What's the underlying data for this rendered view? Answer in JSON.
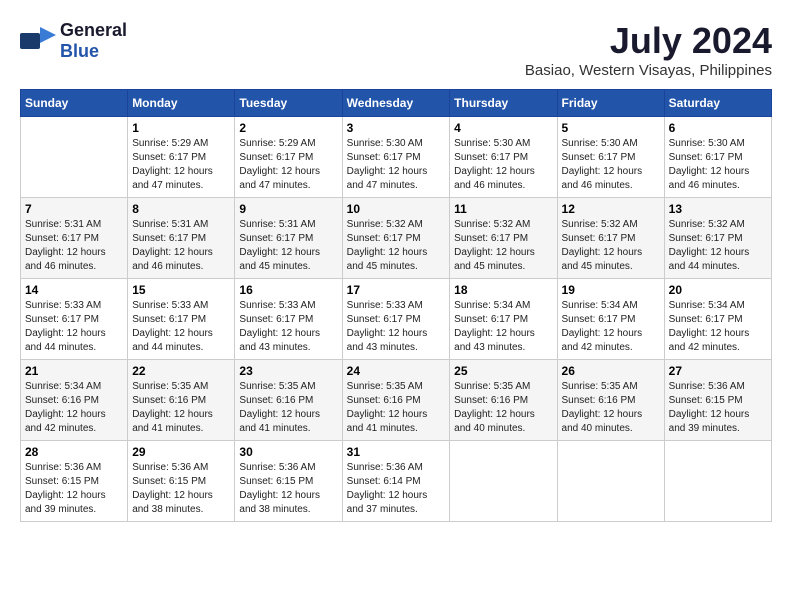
{
  "header": {
    "logo_general": "General",
    "logo_blue": "Blue",
    "title": "July 2024",
    "subtitle": "Basiao, Western Visayas, Philippines"
  },
  "calendar": {
    "days_of_week": [
      "Sunday",
      "Monday",
      "Tuesday",
      "Wednesday",
      "Thursday",
      "Friday",
      "Saturday"
    ],
    "weeks": [
      [
        {
          "day": "",
          "sunrise": "",
          "sunset": "",
          "daylight": ""
        },
        {
          "day": "1",
          "sunrise": "Sunrise: 5:29 AM",
          "sunset": "Sunset: 6:17 PM",
          "daylight": "Daylight: 12 hours and 47 minutes."
        },
        {
          "day": "2",
          "sunrise": "Sunrise: 5:29 AM",
          "sunset": "Sunset: 6:17 PM",
          "daylight": "Daylight: 12 hours and 47 minutes."
        },
        {
          "day": "3",
          "sunrise": "Sunrise: 5:30 AM",
          "sunset": "Sunset: 6:17 PM",
          "daylight": "Daylight: 12 hours and 47 minutes."
        },
        {
          "day": "4",
          "sunrise": "Sunrise: 5:30 AM",
          "sunset": "Sunset: 6:17 PM",
          "daylight": "Daylight: 12 hours and 46 minutes."
        },
        {
          "day": "5",
          "sunrise": "Sunrise: 5:30 AM",
          "sunset": "Sunset: 6:17 PM",
          "daylight": "Daylight: 12 hours and 46 minutes."
        },
        {
          "day": "6",
          "sunrise": "Sunrise: 5:30 AM",
          "sunset": "Sunset: 6:17 PM",
          "daylight": "Daylight: 12 hours and 46 minutes."
        }
      ],
      [
        {
          "day": "7",
          "sunrise": "Sunrise: 5:31 AM",
          "sunset": "Sunset: 6:17 PM",
          "daylight": "Daylight: 12 hours and 46 minutes."
        },
        {
          "day": "8",
          "sunrise": "Sunrise: 5:31 AM",
          "sunset": "Sunset: 6:17 PM",
          "daylight": "Daylight: 12 hours and 46 minutes."
        },
        {
          "day": "9",
          "sunrise": "Sunrise: 5:31 AM",
          "sunset": "Sunset: 6:17 PM",
          "daylight": "Daylight: 12 hours and 45 minutes."
        },
        {
          "day": "10",
          "sunrise": "Sunrise: 5:32 AM",
          "sunset": "Sunset: 6:17 PM",
          "daylight": "Daylight: 12 hours and 45 minutes."
        },
        {
          "day": "11",
          "sunrise": "Sunrise: 5:32 AM",
          "sunset": "Sunset: 6:17 PM",
          "daylight": "Daylight: 12 hours and 45 minutes."
        },
        {
          "day": "12",
          "sunrise": "Sunrise: 5:32 AM",
          "sunset": "Sunset: 6:17 PM",
          "daylight": "Daylight: 12 hours and 45 minutes."
        },
        {
          "day": "13",
          "sunrise": "Sunrise: 5:32 AM",
          "sunset": "Sunset: 6:17 PM",
          "daylight": "Daylight: 12 hours and 44 minutes."
        }
      ],
      [
        {
          "day": "14",
          "sunrise": "Sunrise: 5:33 AM",
          "sunset": "Sunset: 6:17 PM",
          "daylight": "Daylight: 12 hours and 44 minutes."
        },
        {
          "day": "15",
          "sunrise": "Sunrise: 5:33 AM",
          "sunset": "Sunset: 6:17 PM",
          "daylight": "Daylight: 12 hours and 44 minutes."
        },
        {
          "day": "16",
          "sunrise": "Sunrise: 5:33 AM",
          "sunset": "Sunset: 6:17 PM",
          "daylight": "Daylight: 12 hours and 43 minutes."
        },
        {
          "day": "17",
          "sunrise": "Sunrise: 5:33 AM",
          "sunset": "Sunset: 6:17 PM",
          "daylight": "Daylight: 12 hours and 43 minutes."
        },
        {
          "day": "18",
          "sunrise": "Sunrise: 5:34 AM",
          "sunset": "Sunset: 6:17 PM",
          "daylight": "Daylight: 12 hours and 43 minutes."
        },
        {
          "day": "19",
          "sunrise": "Sunrise: 5:34 AM",
          "sunset": "Sunset: 6:17 PM",
          "daylight": "Daylight: 12 hours and 42 minutes."
        },
        {
          "day": "20",
          "sunrise": "Sunrise: 5:34 AM",
          "sunset": "Sunset: 6:17 PM",
          "daylight": "Daylight: 12 hours and 42 minutes."
        }
      ],
      [
        {
          "day": "21",
          "sunrise": "Sunrise: 5:34 AM",
          "sunset": "Sunset: 6:16 PM",
          "daylight": "Daylight: 12 hours and 42 minutes."
        },
        {
          "day": "22",
          "sunrise": "Sunrise: 5:35 AM",
          "sunset": "Sunset: 6:16 PM",
          "daylight": "Daylight: 12 hours and 41 minutes."
        },
        {
          "day": "23",
          "sunrise": "Sunrise: 5:35 AM",
          "sunset": "Sunset: 6:16 PM",
          "daylight": "Daylight: 12 hours and 41 minutes."
        },
        {
          "day": "24",
          "sunrise": "Sunrise: 5:35 AM",
          "sunset": "Sunset: 6:16 PM",
          "daylight": "Daylight: 12 hours and 41 minutes."
        },
        {
          "day": "25",
          "sunrise": "Sunrise: 5:35 AM",
          "sunset": "Sunset: 6:16 PM",
          "daylight": "Daylight: 12 hours and 40 minutes."
        },
        {
          "day": "26",
          "sunrise": "Sunrise: 5:35 AM",
          "sunset": "Sunset: 6:16 PM",
          "daylight": "Daylight: 12 hours and 40 minutes."
        },
        {
          "day": "27",
          "sunrise": "Sunrise: 5:36 AM",
          "sunset": "Sunset: 6:15 PM",
          "daylight": "Daylight: 12 hours and 39 minutes."
        }
      ],
      [
        {
          "day": "28",
          "sunrise": "Sunrise: 5:36 AM",
          "sunset": "Sunset: 6:15 PM",
          "daylight": "Daylight: 12 hours and 39 minutes."
        },
        {
          "day": "29",
          "sunrise": "Sunrise: 5:36 AM",
          "sunset": "Sunset: 6:15 PM",
          "daylight": "Daylight: 12 hours and 38 minutes."
        },
        {
          "day": "30",
          "sunrise": "Sunrise: 5:36 AM",
          "sunset": "Sunset: 6:15 PM",
          "daylight": "Daylight: 12 hours and 38 minutes."
        },
        {
          "day": "31",
          "sunrise": "Sunrise: 5:36 AM",
          "sunset": "Sunset: 6:14 PM",
          "daylight": "Daylight: 12 hours and 37 minutes."
        },
        {
          "day": "",
          "sunrise": "",
          "sunset": "",
          "daylight": ""
        },
        {
          "day": "",
          "sunrise": "",
          "sunset": "",
          "daylight": ""
        },
        {
          "day": "",
          "sunrise": "",
          "sunset": "",
          "daylight": ""
        }
      ]
    ]
  }
}
